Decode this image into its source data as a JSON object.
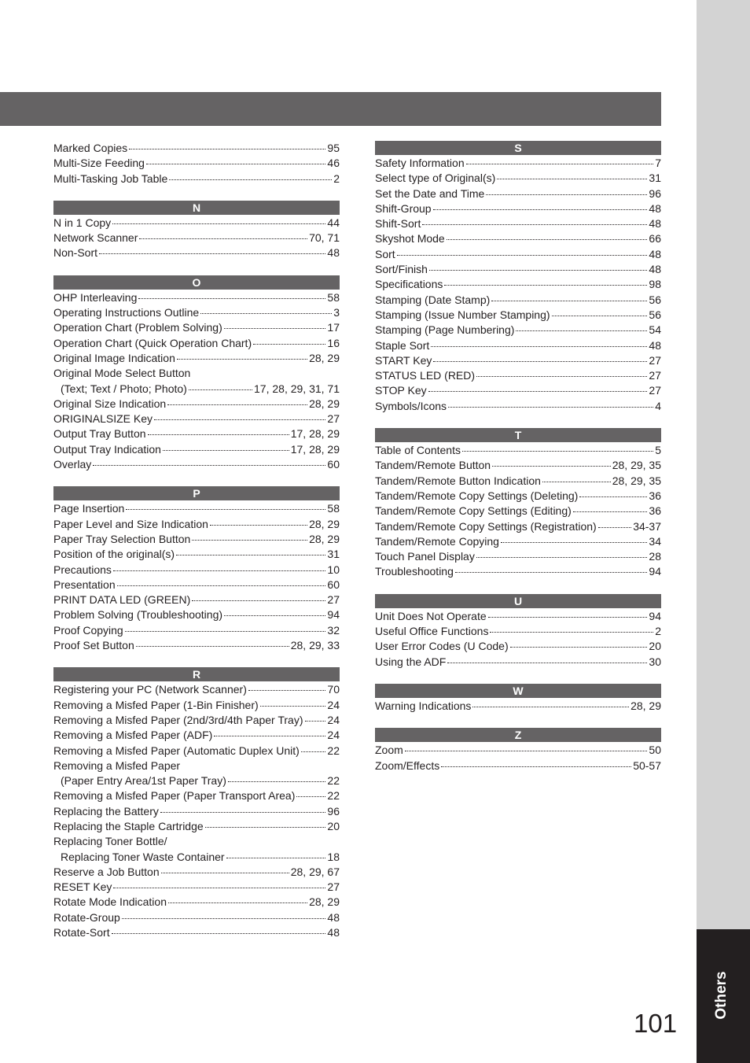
{
  "side_tab": {
    "label": "Others"
  },
  "page_number": "101",
  "colors": {
    "header_bar": "#656364",
    "tab_light": "#d3d3d3",
    "tab_dark": "#231f20",
    "text": "#231f20"
  },
  "left_column": {
    "sections": [
      {
        "letter": "",
        "entries": [
          {
            "term": "Marked Copies",
            "pages": "95"
          },
          {
            "term": "Multi-Size Feeding",
            "pages": "46"
          },
          {
            "term": "Multi-Tasking Job Table",
            "pages": "2"
          }
        ]
      },
      {
        "letter": "N",
        "entries": [
          {
            "term": "N in 1 Copy",
            "pages": "44"
          },
          {
            "term": "Network Scanner",
            "pages": "70, 71"
          },
          {
            "term": "Non-Sort",
            "pages": "48"
          }
        ]
      },
      {
        "letter": "O",
        "entries": [
          {
            "term": "OHP Interleaving",
            "pages": "58"
          },
          {
            "term": "Operating Instructions Outline",
            "pages": "3"
          },
          {
            "term": "Operation Chart (Problem Solving)",
            "pages": "17"
          },
          {
            "term": "Operation Chart (Quick Operation Chart)",
            "pages": "16"
          },
          {
            "term": "Original Image Indication",
            "pages": "28, 29"
          },
          {
            "term": "Original Mode Select Button",
            "pages": ""
          },
          {
            "term": "(Text; Text / Photo; Photo)",
            "pages": "17,  28,  29, 31, 71",
            "cont": true
          },
          {
            "term": "Original Size Indication",
            "pages": "28, 29"
          },
          {
            "term": "ORIGINALSIZE Key",
            "pages": "27"
          },
          {
            "term": "Output Tray Button",
            "pages": "17, 28, 29"
          },
          {
            "term": "Output Tray Indication",
            "pages": "17, 28, 29"
          },
          {
            "term": "Overlay",
            "pages": "60"
          }
        ]
      },
      {
        "letter": "P",
        "entries": [
          {
            "term": "Page Insertion",
            "pages": "58"
          },
          {
            "term": "Paper Level and Size Indication",
            "pages": "28, 29"
          },
          {
            "term": "Paper Tray Selection Button",
            "pages": "28, 29"
          },
          {
            "term": "Position of the original(s)",
            "pages": "31"
          },
          {
            "term": "Precautions",
            "pages": "10"
          },
          {
            "term": "Presentation",
            "pages": "60"
          },
          {
            "term": "PRINT DATA LED (GREEN)",
            "pages": "27"
          },
          {
            "term": "Problem Solving (Troubleshooting)",
            "pages": "94"
          },
          {
            "term": "Proof Copying",
            "pages": "32"
          },
          {
            "term": "Proof Set Button",
            "pages": "28, 29, 33"
          }
        ]
      },
      {
        "letter": "R",
        "entries": [
          {
            "term": "Registering your PC (Network Scanner)",
            "pages": "70"
          },
          {
            "term": "Removing a Misfed Paper (1-Bin Finisher)",
            "pages": "24"
          },
          {
            "term": "Removing a Misfed Paper (2nd/3rd/4th Paper Tray)",
            "pages": "24"
          },
          {
            "term": "Removing a Misfed Paper (ADF)",
            "pages": "24"
          },
          {
            "term": "Removing a Misfed Paper (Automatic Duplex Unit)",
            "pages": "22"
          },
          {
            "term": "Removing a Misfed Paper",
            "pages": ""
          },
          {
            "term": "(Paper Entry Area/1st Paper Tray)",
            "pages": "22",
            "cont": true
          },
          {
            "term": "Removing a Misfed Paper (Paper Transport Area)",
            "pages": "22"
          },
          {
            "term": "Replacing the Battery",
            "pages": "96"
          },
          {
            "term": "Replacing the Staple Cartridge",
            "pages": "20"
          },
          {
            "term": "Replacing Toner Bottle/",
            "pages": ""
          },
          {
            "term": "Replacing Toner Waste Container",
            "pages": "18",
            "cont": true
          },
          {
            "term": "Reserve a Job Button",
            "pages": "28, 29, 67"
          },
          {
            "term": "RESET Key",
            "pages": "27"
          },
          {
            "term": "Rotate Mode Indication",
            "pages": "28, 29"
          },
          {
            "term": "Rotate-Group",
            "pages": "48"
          },
          {
            "term": "Rotate-Sort",
            "pages": "48"
          }
        ]
      }
    ]
  },
  "right_column": {
    "sections": [
      {
        "letter": "S",
        "entries": [
          {
            "term": "Safety Information",
            "pages": "7"
          },
          {
            "term": "Select type of Original(s)",
            "pages": "31"
          },
          {
            "term": "Set the Date and Time",
            "pages": "96"
          },
          {
            "term": "Shift-Group",
            "pages": "48"
          },
          {
            "term": "Shift-Sort",
            "pages": "48"
          },
          {
            "term": "Skyshot Mode",
            "pages": "66"
          },
          {
            "term": "Sort",
            "pages": "48"
          },
          {
            "term": "Sort/Finish",
            "pages": "48"
          },
          {
            "term": "Specifications",
            "pages": "98"
          },
          {
            "term": "Stamping (Date Stamp)",
            "pages": "56"
          },
          {
            "term": "Stamping (Issue Number Stamping)",
            "pages": "56"
          },
          {
            "term": "Stamping (Page Numbering)",
            "pages": "54"
          },
          {
            "term": "Staple Sort",
            "pages": "48"
          },
          {
            "term": "START Key",
            "pages": "27"
          },
          {
            "term": "STATUS LED (RED)",
            "pages": "27"
          },
          {
            "term": "STOP Key",
            "pages": "27"
          },
          {
            "term": "Symbols/Icons",
            "pages": "4"
          }
        ]
      },
      {
        "letter": "T",
        "entries": [
          {
            "term": "Table of Contents",
            "pages": "5"
          },
          {
            "term": "Tandem/Remote Button",
            "pages": "28, 29, 35"
          },
          {
            "term": "Tandem/Remote Button Indication",
            "pages": "28, 29, 35"
          },
          {
            "term": "Tandem/Remote Copy Settings (Deleting)",
            "pages": "36"
          },
          {
            "term": "Tandem/Remote Copy Settings (Editing)",
            "pages": "36"
          },
          {
            "term": "Tandem/Remote Copy Settings (Registration)",
            "pages": "34-37"
          },
          {
            "term": "Tandem/Remote Copying",
            "pages": "34"
          },
          {
            "term": "Touch Panel Display",
            "pages": "28"
          },
          {
            "term": "Troubleshooting",
            "pages": "94"
          }
        ]
      },
      {
        "letter": "U",
        "entries": [
          {
            "term": "Unit Does Not Operate",
            "pages": "94"
          },
          {
            "term": "Useful Office Functions",
            "pages": "2"
          },
          {
            "term": "User Error Codes (U Code)",
            "pages": "20"
          },
          {
            "term": "Using the ADF",
            "pages": "30"
          }
        ]
      },
      {
        "letter": "W",
        "entries": [
          {
            "term": "Warning Indications",
            "pages": "28, 29"
          }
        ]
      },
      {
        "letter": "Z",
        "entries": [
          {
            "term": "Zoom",
            "pages": "50"
          },
          {
            "term": "Zoom/Effects",
            "pages": "50-57"
          }
        ]
      }
    ]
  }
}
